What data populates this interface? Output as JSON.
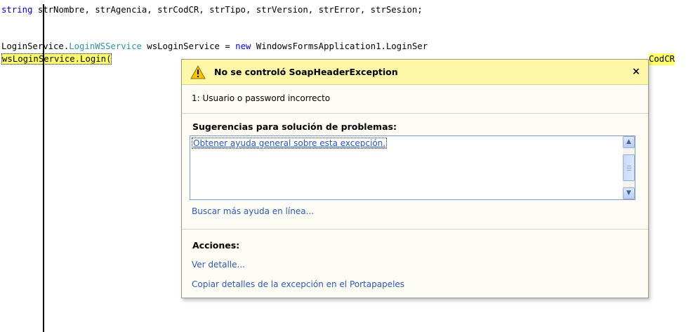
{
  "editor": {
    "line1": {
      "keyword": "string",
      "rest": " strNombre, strAgencia, strCodCR, strTipo, strVersion, strError, strSesion;"
    },
    "line2": {
      "prefix": "LoginService.",
      "type": "LoginWSService",
      "mid": " wsLoginService = ",
      "keyword": "new",
      "suffix": " WindowsFormsApplication1.LoginSer"
    },
    "line3": {
      "highlighted": "wsLoginService.Login(",
      "tail": "CodCR"
    }
  },
  "exception_assistant": {
    "title": "No se controló SoapHeaderException",
    "close_label": "×",
    "message": "1: Usuario o password incorrecto",
    "suggestions_title": "Sugerencias para solución de problemas:",
    "suggestions": [
      "Obtener ayuda general sobre esta excepción."
    ],
    "online_help": "Buscar más ayuda en línea...",
    "actions_title": "Acciones:",
    "actions": [
      "Ver detalle...",
      "Copiar detalles de la excepción en el Portapapeles"
    ]
  },
  "colors": {
    "keyword": "#0000ff",
    "type": "#2b91af",
    "highlight": "#ffff66",
    "header": "#fff7a8",
    "link": "#2a59b8"
  },
  "icons": [
    "warning-icon",
    "close-icon",
    "scroll-up-arrow-icon",
    "scroll-down-arrow-icon"
  ]
}
